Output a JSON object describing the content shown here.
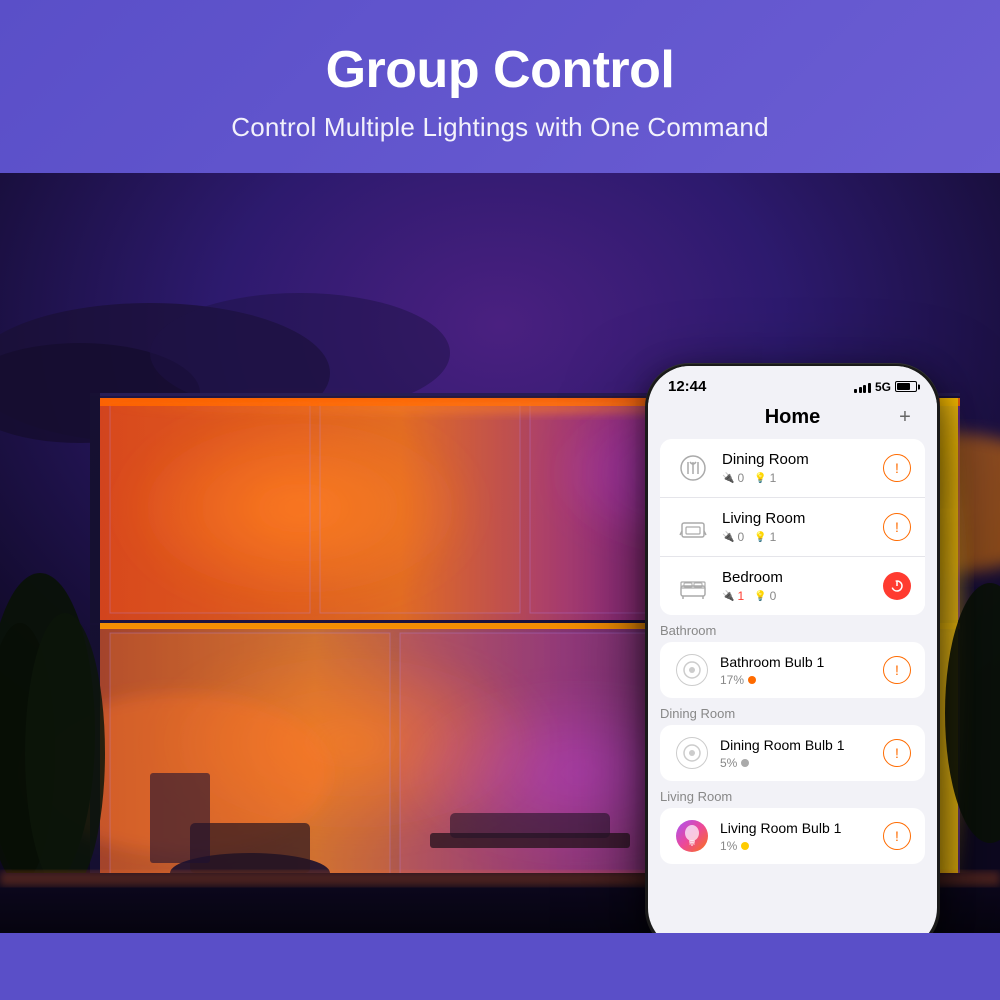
{
  "header": {
    "title": "Group Control",
    "subtitle": "Control Multiple Lightings with One Command"
  },
  "phone": {
    "status_bar": {
      "time": "12:44",
      "signal_label": "5G",
      "battery_label": "🔋"
    },
    "app_title": "Home",
    "add_button_label": "+",
    "rooms": [
      {
        "name": "Dining Room",
        "icon": "🍽",
        "stat1": "0",
        "stat2": "1",
        "action": "warning"
      },
      {
        "name": "Living Room",
        "icon": "🛋",
        "stat1": "0",
        "stat2": "1",
        "action": "warning"
      },
      {
        "name": "Bedroom",
        "icon": "🛏",
        "stat1": "1",
        "stat2": "0",
        "action": "power"
      }
    ],
    "sections": [
      {
        "label": "Bathroom",
        "devices": [
          {
            "name": "Bathroom Bulb 1",
            "percentage": "17%",
            "status_color": "orange",
            "action": "warning",
            "icon_type": "circle_gray"
          }
        ]
      },
      {
        "label": "Dining Room",
        "devices": [
          {
            "name": "Dining Room Bulb 1",
            "percentage": "5%",
            "status_color": "gray",
            "action": "warning",
            "icon_type": "circle_gray"
          }
        ]
      },
      {
        "label": "Living Room",
        "devices": [
          {
            "name": "Living Room Bulb 1",
            "percentage": "1%",
            "status_color": "yellow",
            "action": "warning",
            "icon_type": "circle_colored"
          }
        ]
      }
    ]
  }
}
